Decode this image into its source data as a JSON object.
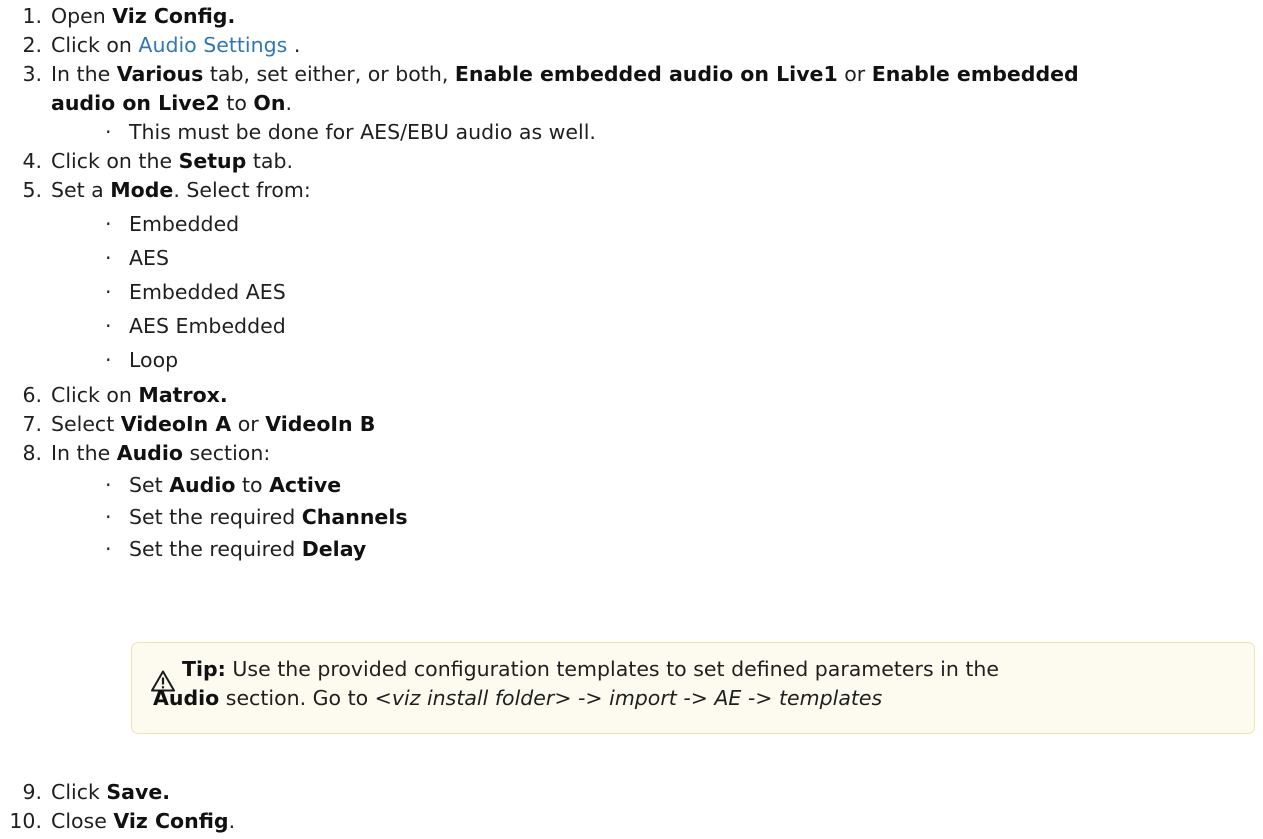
{
  "steps": {
    "s1": {
      "num": "1.",
      "t1": "Open ",
      "b1": "Viz Config."
    },
    "s2": {
      "num": "2.",
      "t1": "Click on ",
      "link": "Audio Settings",
      "t2": " ."
    },
    "s3": {
      "num": "3.",
      "t1": "In the ",
      "b1": "Various",
      "t2": " tab, set either, or both, ",
      "b2": "Enable embedded audio on Live1",
      "t3": " or ",
      "b3": "Enable embedded",
      "b4": "audio on Live2",
      "t4": " to ",
      "b5": "On",
      "t5": ".",
      "sub1": "This must be done for AES/EBU audio as well."
    },
    "s4": {
      "num": "4.",
      "t1": "Click on the ",
      "b1": "Setup",
      "t2": " tab."
    },
    "s5": {
      "num": "5.",
      "t1": "Set a ",
      "b1": "Mode",
      "t2": ". Select from:",
      "options": [
        "Embedded",
        "AES",
        "Embedded AES",
        "AES Embedded",
        "Loop"
      ]
    },
    "s6": {
      "num": "6.",
      "t1": "Click on ",
      "b1": "Matrox."
    },
    "s7": {
      "num": "7.",
      "t1": "Select ",
      "b1": "VideoIn A",
      "t2": " or ",
      "b2": "VideoIn B"
    },
    "s8": {
      "num": "8.",
      "t1": "In the ",
      "b1": "Audio",
      "t2": " section:",
      "sub1": {
        "t1": "Set ",
        "b1": "Audio",
        "t2": " to ",
        "b2": "Active"
      },
      "sub2": {
        "t1": "Set the required ",
        "b1": "Channels"
      },
      "sub3": {
        "t1": "Set the required ",
        "b1": "Delay"
      }
    },
    "s9": {
      "num": "9.",
      "t1": "Click ",
      "b1": "Save."
    },
    "s10": {
      "num": "10.",
      "t1": "Close ",
      "b1": "Viz Config",
      "t2": "."
    }
  },
  "bullet": "·",
  "tip": {
    "label": "Tip:",
    "line1": " Use the provided configuration templates to set defined parameters in the",
    "b1": "Audio",
    "line2": " section. Go to ",
    "path": "<viz install folder> -> import -> AE -> templates",
    "icon": "warning-icon",
    "bg_color": "#fdfbf0",
    "border_color": "#f3e3ad"
  },
  "colors": {
    "link": "#2f78b5",
    "text": "#1f1f1f"
  }
}
